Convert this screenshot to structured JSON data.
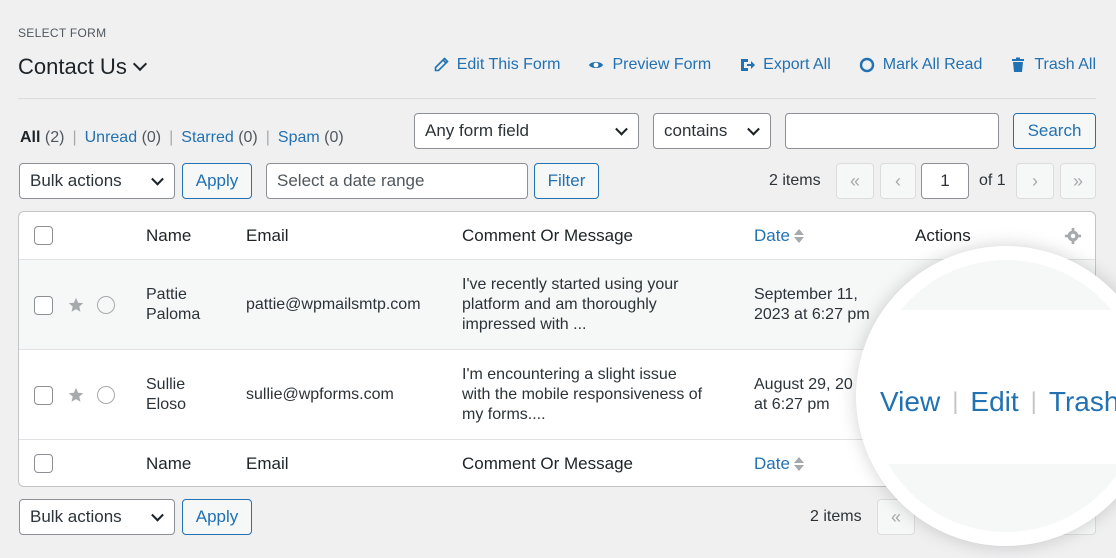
{
  "header": {
    "select_form_label": "SELECT FORM",
    "form_title": "Contact Us",
    "actions": [
      {
        "label": "Edit This Form",
        "icon": "pencil-icon"
      },
      {
        "label": "Preview Form",
        "icon": "eye-icon"
      },
      {
        "label": "Export All",
        "icon": "export-icon"
      },
      {
        "label": "Mark All Read",
        "icon": "circle-icon"
      },
      {
        "label": "Trash All",
        "icon": "trash-icon"
      }
    ]
  },
  "views": {
    "all": "All",
    "all_count": "(2)",
    "unread": "Unread",
    "unread_count": "(0)",
    "starred": "Starred",
    "starred_count": "(0)",
    "spam": "Spam",
    "spam_count": "(0)",
    "sep": "|"
  },
  "search": {
    "field_select": "Any form field",
    "operator_select": "contains",
    "query_value": "",
    "button": "Search"
  },
  "tablenav_top": {
    "bulk_actions": "Bulk actions",
    "apply": "Apply",
    "date_placeholder": "Select a date range",
    "filter": "Filter",
    "items": "2 items",
    "first": "«",
    "prev": "‹",
    "page": "1",
    "of_pages": "of 1",
    "next": "›",
    "last": "»"
  },
  "table": {
    "columns": {
      "name": "Name",
      "email": "Email",
      "message": "Comment Or Message",
      "date": "Date",
      "actions": "Actions"
    },
    "rows": [
      {
        "name_line1": "Pattie",
        "name_line2": "Paloma",
        "email": "pattie@wpmailsmtp.com",
        "msg_line1": "I've recently started using your",
        "msg_line2": "platform and am thoroughly",
        "msg_line3": "impressed with ...",
        "date_line1": "September 11,",
        "date_line2": "2023 at 6:27 pm"
      },
      {
        "name_line1": "Sullie",
        "name_line2": "Eloso",
        "email": "sullie@wpforms.com",
        "msg_line1": "I'm encountering a slight issue",
        "msg_line2": "with the mobile responsiveness of",
        "msg_line3": "my forms....",
        "date_line1": "August 29, 20",
        "date_line2": "at 6:27 pm"
      }
    ]
  },
  "magnifier": {
    "view": "View",
    "edit": "Edit",
    "trash": "Trash",
    "sep": "|"
  },
  "tablenav_bottom": {
    "bulk_actions": "Bulk actions",
    "apply": "Apply",
    "items": "2 items",
    "first": "«",
    "last": "»"
  },
  "colors": {
    "accent": "#2271b1",
    "background": "#f0f0f1",
    "border": "#8c8f94"
  }
}
